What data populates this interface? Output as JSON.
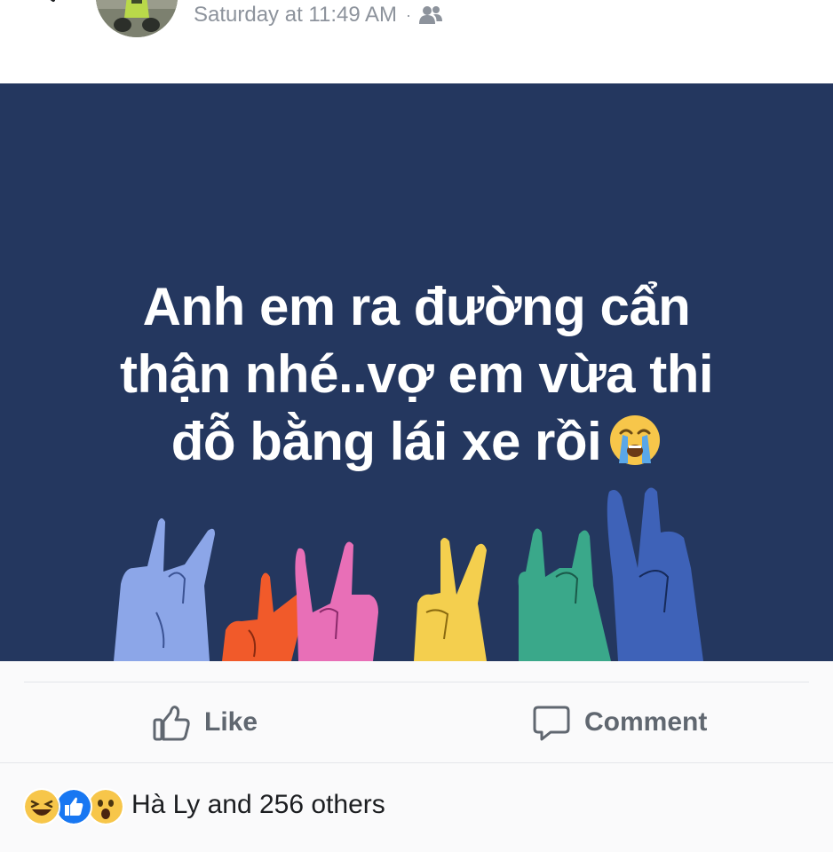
{
  "header": {
    "timestamp": "Saturday at 11:49 AM",
    "separator": "·",
    "audience_icon": "friends-icon",
    "back_icon": "chevron-left-icon"
  },
  "post": {
    "background_color": "#24375f",
    "text_lines": [
      "Anh em ra đường cẩn",
      "thận nhé..vợ em vừa thi",
      "đỗ bằng lái xe rồi"
    ],
    "emoji": "loudly-crying-face-emoji"
  },
  "actions": {
    "like_label": "Like",
    "comment_label": "Comment",
    "like_icon": "thumbs-up-outline-icon",
    "comment_icon": "speech-bubble-icon"
  },
  "reactions": {
    "icons": [
      "haha-reaction-icon",
      "like-reaction-icon",
      "wow-reaction-icon"
    ],
    "summary": "Hà Ly and 256 others"
  },
  "colors": {
    "banner": "#24375f",
    "action_text": "#606770",
    "meta_text": "#8d939c",
    "like_blue": "#1877f2",
    "emoji_yellow": "#f7c64a"
  }
}
